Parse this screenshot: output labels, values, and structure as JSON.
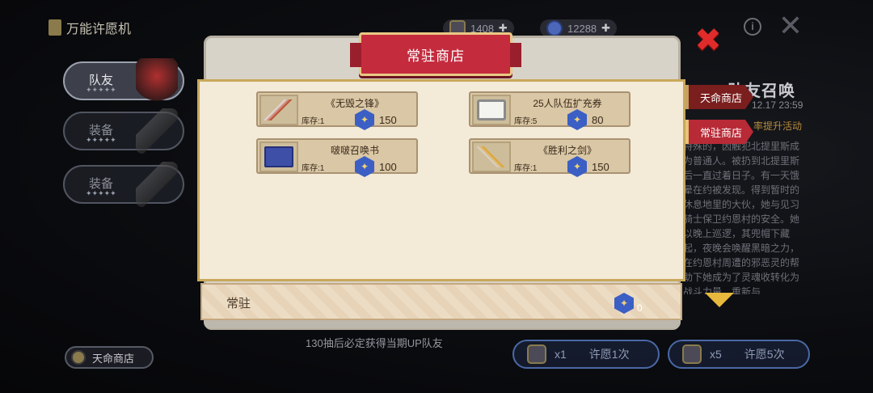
{
  "topbar": {
    "title": "万能许愿机",
    "currency1": "1408",
    "currency2": "12288",
    "plus": "✚"
  },
  "left_tabs": [
    {
      "label": "队友",
      "active": true
    },
    {
      "label": "装备",
      "active": false
    },
    {
      "label": "装备",
      "active": false
    }
  ],
  "destiny_shop_button": "天命商店",
  "bottom_hint": "130抽后必定获得当期UP队友",
  "wish_buttons": [
    {
      "count": "x1",
      "label": "许愿1次"
    },
    {
      "count": "x5",
      "label": "许愿5次"
    }
  ],
  "right_panel": {
    "title": "队友召唤",
    "date": "12.17 23:59",
    "event": "率提升活动",
    "description": "特殊的，因触犯北提里斯成为普通人。被扔到北提里斯后一直过着日子。有一天饿晕在约被发现。得到暂时的休息地里的大伙，她与见习骑士保卫约恩村的安全。她以晚上巡逻，其兜帽下藏起，夜晚会唤醒黑暗之力，在约恩村周遭的邪恶灵的帮助下她成为了灵魂收转化为战斗力量，重新与"
  },
  "side_tabs": [
    "天命商店",
    "常驻商店"
  ],
  "modal": {
    "title": "常驻商店",
    "items": [
      {
        "name": "《无毁之锋》",
        "stock": "库存:1",
        "price": "150",
        "icon": "sword-icon"
      },
      {
        "name": "25人队伍扩充券",
        "stock": "库存:5",
        "price": "80",
        "icon": "ticket-icon"
      },
      {
        "name": "啵啵召唤书",
        "stock": "库存:1",
        "price": "100",
        "icon": "book-icon"
      },
      {
        "name": "《胜利之剑》",
        "stock": "库存:1",
        "price": "150",
        "icon": "sword-icon"
      }
    ],
    "footer_label": "常驻",
    "footer_balance": "0",
    "gem_glyph": "✦"
  },
  "colors": {
    "banner": "#c42c3e",
    "close": "#e02b2b",
    "gem": "#3b5fc4",
    "accent": "#e7b93c"
  }
}
